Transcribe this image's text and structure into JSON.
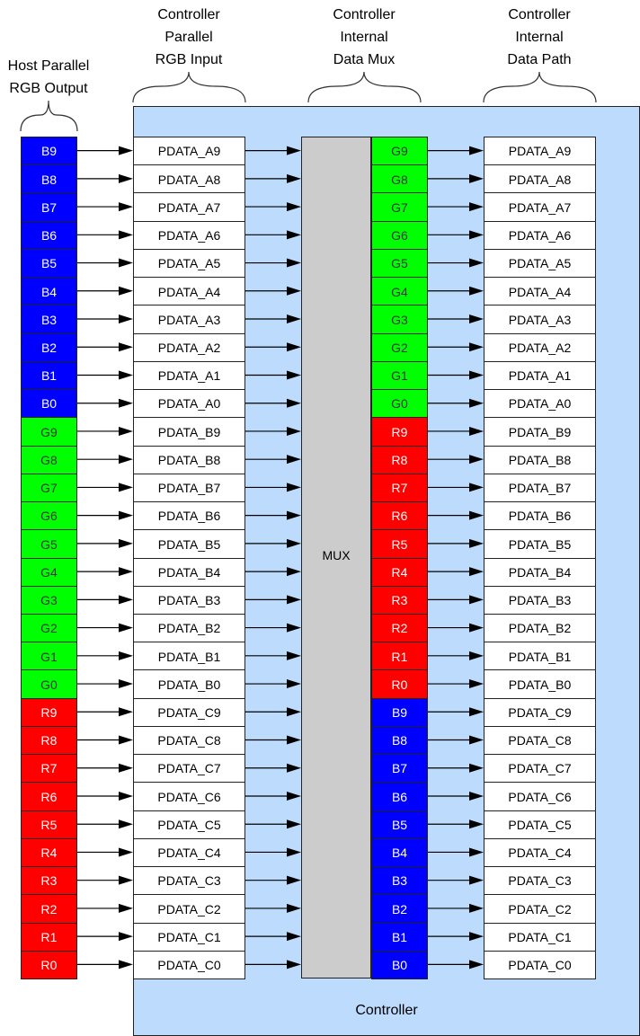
{
  "headers": {
    "host": "Host Parallel\nRGB Output",
    "input": "Controller\nParallel\nRGB Input",
    "mux": "Controller\nInternal\nData Mux",
    "path": "Controller\nInternal\nData Path"
  },
  "mux_label": "MUX",
  "controller_label": "Controller",
  "colors": {
    "blue": "#0000FF",
    "green": "#00FF00",
    "red": "#FF0000",
    "controller_fill": "#BDDCFD",
    "mux_fill": "#CCCCCC"
  },
  "host_column": [
    {
      "label": "B9",
      "color": "blue"
    },
    {
      "label": "B8",
      "color": "blue"
    },
    {
      "label": "B7",
      "color": "blue"
    },
    {
      "label": "B6",
      "color": "blue"
    },
    {
      "label": "B5",
      "color": "blue"
    },
    {
      "label": "B4",
      "color": "blue"
    },
    {
      "label": "B3",
      "color": "blue"
    },
    {
      "label": "B2",
      "color": "blue"
    },
    {
      "label": "B1",
      "color": "blue"
    },
    {
      "label": "B0",
      "color": "blue"
    },
    {
      "label": "G9",
      "color": "green"
    },
    {
      "label": "G8",
      "color": "green"
    },
    {
      "label": "G7",
      "color": "green"
    },
    {
      "label": "G6",
      "color": "green"
    },
    {
      "label": "G5",
      "color": "green"
    },
    {
      "label": "G4",
      "color": "green"
    },
    {
      "label": "G3",
      "color": "green"
    },
    {
      "label": "G2",
      "color": "green"
    },
    {
      "label": "G1",
      "color": "green"
    },
    {
      "label": "G0",
      "color": "green"
    },
    {
      "label": "R9",
      "color": "red"
    },
    {
      "label": "R8",
      "color": "red"
    },
    {
      "label": "R7",
      "color": "red"
    },
    {
      "label": "R6",
      "color": "red"
    },
    {
      "label": "R5",
      "color": "red"
    },
    {
      "label": "R4",
      "color": "red"
    },
    {
      "label": "R3",
      "color": "red"
    },
    {
      "label": "R2",
      "color": "red"
    },
    {
      "label": "R1",
      "color": "red"
    },
    {
      "label": "R0",
      "color": "red"
    }
  ],
  "input_column": [
    "PDATA_A9",
    "PDATA_A8",
    "PDATA_A7",
    "PDATA_A6",
    "PDATA_A5",
    "PDATA_A4",
    "PDATA_A3",
    "PDATA_A2",
    "PDATA_A1",
    "PDATA_A0",
    "PDATA_B9",
    "PDATA_B8",
    "PDATA_B7",
    "PDATA_B6",
    "PDATA_B5",
    "PDATA_B4",
    "PDATA_B3",
    "PDATA_B2",
    "PDATA_B1",
    "PDATA_B0",
    "PDATA_C9",
    "PDATA_C8",
    "PDATA_C7",
    "PDATA_C6",
    "PDATA_C5",
    "PDATA_C4",
    "PDATA_C3",
    "PDATA_C2",
    "PDATA_C1",
    "PDATA_C0"
  ],
  "mux_column": [
    {
      "label": "G9",
      "color": "green"
    },
    {
      "label": "G8",
      "color": "green"
    },
    {
      "label": "G7",
      "color": "green"
    },
    {
      "label": "G6",
      "color": "green"
    },
    {
      "label": "G5",
      "color": "green"
    },
    {
      "label": "G4",
      "color": "green"
    },
    {
      "label": "G3",
      "color": "green"
    },
    {
      "label": "G2",
      "color": "green"
    },
    {
      "label": "G1",
      "color": "green"
    },
    {
      "label": "G0",
      "color": "green"
    },
    {
      "label": "R9",
      "color": "red"
    },
    {
      "label": "R8",
      "color": "red"
    },
    {
      "label": "R7",
      "color": "red"
    },
    {
      "label": "R6",
      "color": "red"
    },
    {
      "label": "R5",
      "color": "red"
    },
    {
      "label": "R4",
      "color": "red"
    },
    {
      "label": "R3",
      "color": "red"
    },
    {
      "label": "R2",
      "color": "red"
    },
    {
      "label": "R1",
      "color": "red"
    },
    {
      "label": "R0",
      "color": "red"
    },
    {
      "label": "B9",
      "color": "blue"
    },
    {
      "label": "B8",
      "color": "blue"
    },
    {
      "label": "B7",
      "color": "blue"
    },
    {
      "label": "B6",
      "color": "blue"
    },
    {
      "label": "B5",
      "color": "blue"
    },
    {
      "label": "B4",
      "color": "blue"
    },
    {
      "label": "B3",
      "color": "blue"
    },
    {
      "label": "B2",
      "color": "blue"
    },
    {
      "label": "B1",
      "color": "blue"
    },
    {
      "label": "B0",
      "color": "blue"
    }
  ],
  "path_column": [
    "PDATA_A9",
    "PDATA_A8",
    "PDATA_A7",
    "PDATA_A6",
    "PDATA_A5",
    "PDATA_A4",
    "PDATA_A3",
    "PDATA_A2",
    "PDATA_A1",
    "PDATA_A0",
    "PDATA_B9",
    "PDATA_B8",
    "PDATA_B7",
    "PDATA_B6",
    "PDATA_B5",
    "PDATA_B4",
    "PDATA_B3",
    "PDATA_B2",
    "PDATA_B1",
    "PDATA_B0",
    "PDATA_C9",
    "PDATA_C8",
    "PDATA_C7",
    "PDATA_C6",
    "PDATA_C5",
    "PDATA_C4",
    "PDATA_C3",
    "PDATA_C2",
    "PDATA_C1",
    "PDATA_C0"
  ]
}
